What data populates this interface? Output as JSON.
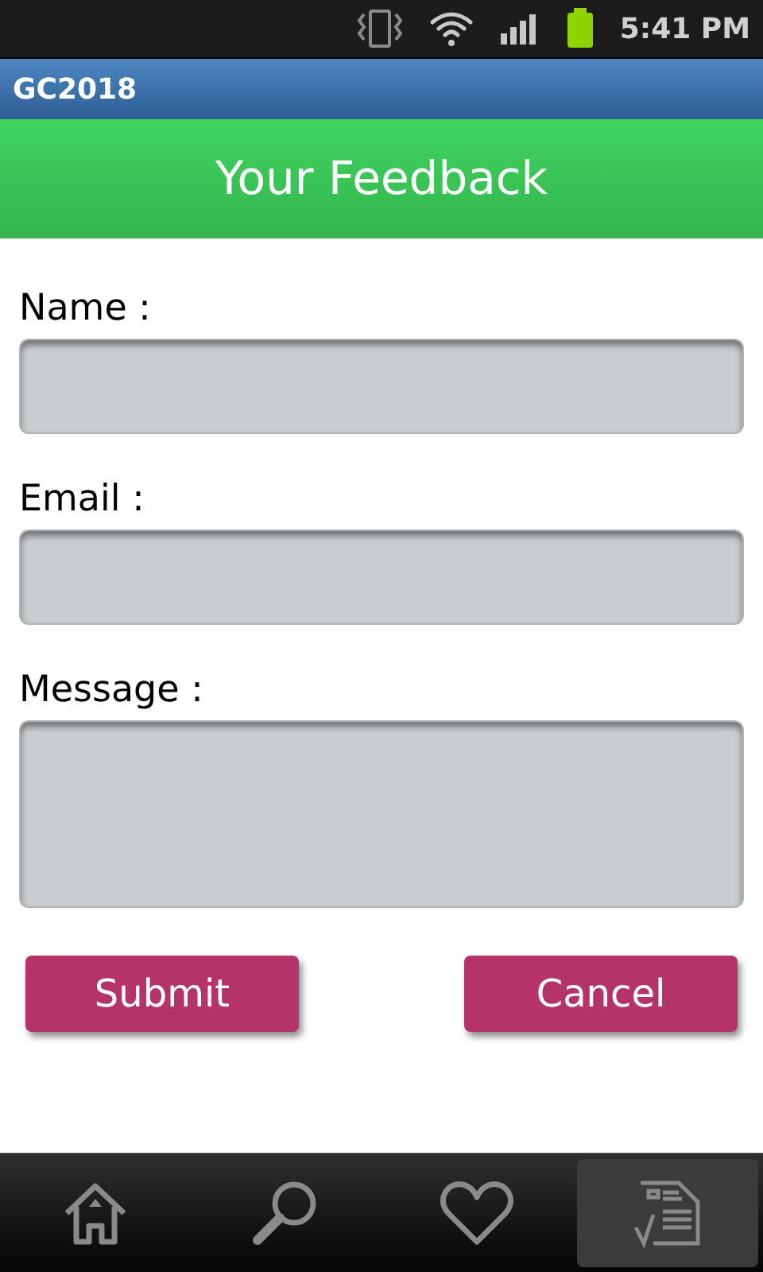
{
  "status_bar": {
    "time": "5:41 PM"
  },
  "app_bar": {
    "title": "GC2018"
  },
  "header": {
    "title": "Your Feedback"
  },
  "fields": [
    {
      "label": "Name :",
      "kind": "line"
    },
    {
      "label": "Email :",
      "kind": "line"
    },
    {
      "label": "Message :",
      "kind": "multiline"
    }
  ],
  "buttons": [
    {
      "label": "Submit"
    },
    {
      "label": "Cancel"
    }
  ],
  "nav": [
    {
      "kind": "home",
      "selected": false
    },
    {
      "kind": "search",
      "selected": false
    },
    {
      "kind": "favorites",
      "selected": false
    },
    {
      "kind": "form",
      "selected": true
    }
  ]
}
